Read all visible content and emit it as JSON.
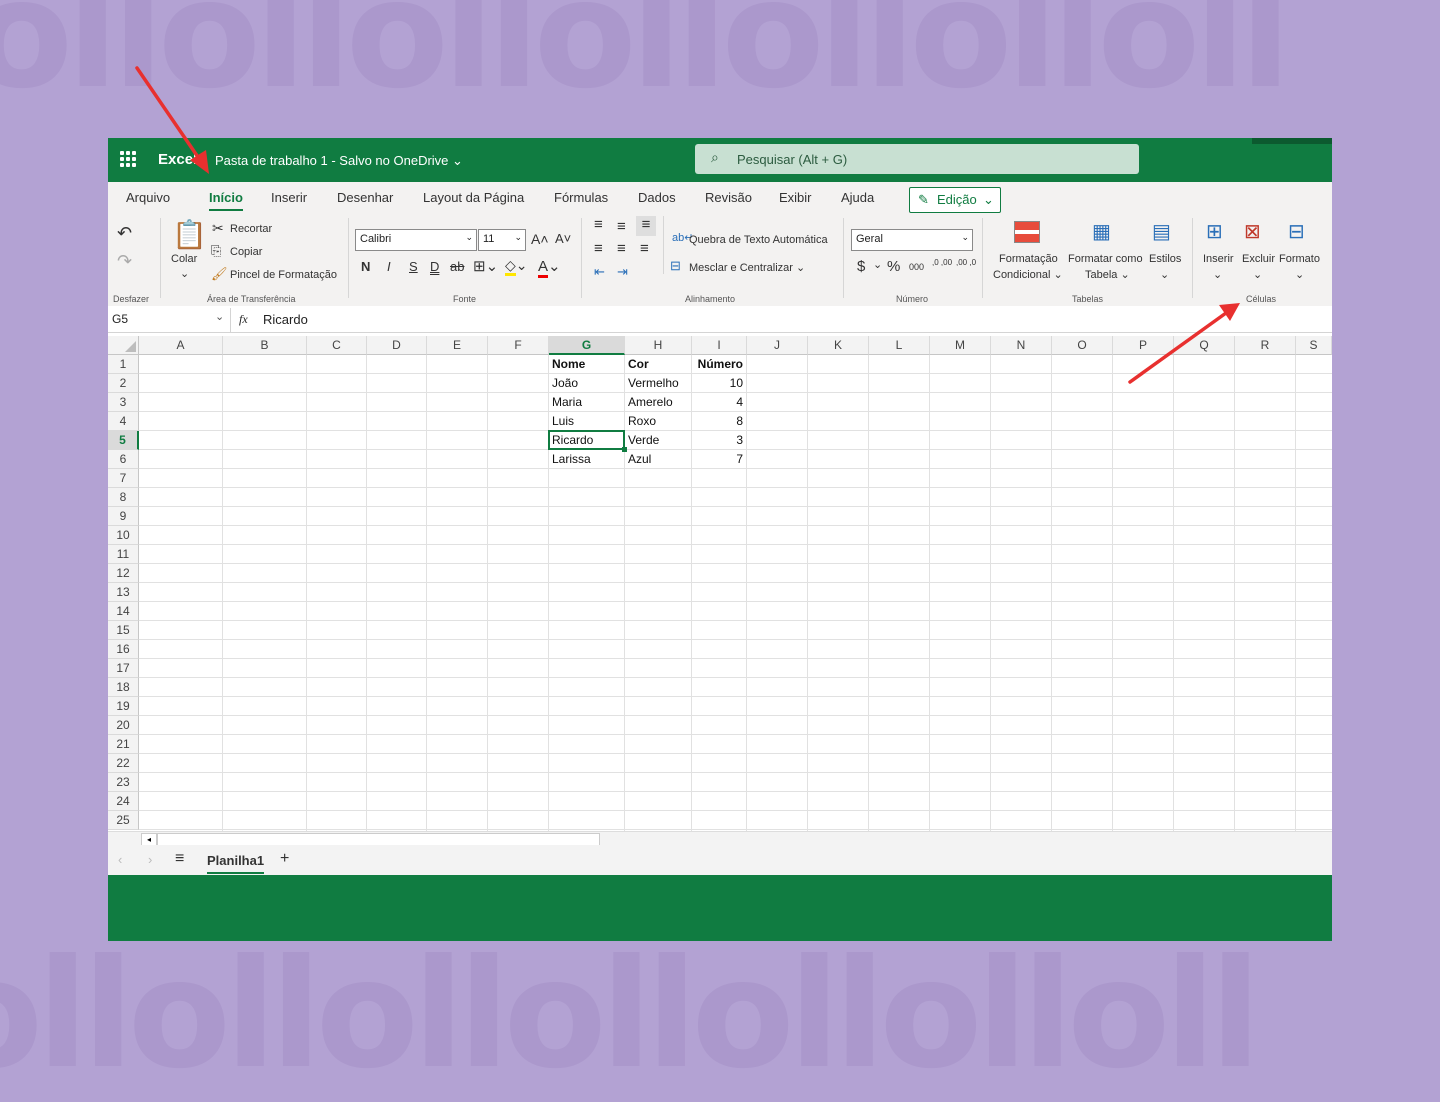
{
  "titlebar": {
    "app_name": "Excel",
    "doc_title": "Pasta de trabalho 1  -  Salvo no OneDrive ⌄",
    "search_placeholder": "Pesquisar (Alt + G)"
  },
  "ribbon": {
    "tabs": [
      "Arquivo",
      "Início",
      "Inserir",
      "Desenhar",
      "Layout da Página",
      "Fórmulas",
      "Dados",
      "Revisão",
      "Exibir",
      "Ajuda"
    ],
    "active_tab": "Início",
    "mode_button": "Edição",
    "clipboard": {
      "paste": "Colar",
      "cut": "Recortar",
      "copy": "Copiar",
      "format_painter": "Pincel de Formatação"
    },
    "font": {
      "family": "Calibri",
      "size": "11",
      "bold": "N",
      "italic": "I",
      "underline": "S",
      "double_underline": "D"
    },
    "alignment": {
      "wrap_text": "Quebra de Texto Automática",
      "merge_center": "Mesclar e Centralizar ⌄"
    },
    "number": {
      "format": "Geral",
      "currency": "$",
      "percent": "%",
      "thousands": "000",
      "inc_decimal": ",0 ,00",
      "dec_decimal": ",00 ,0"
    },
    "tables": {
      "conditional_format": "Formatação",
      "conditional_format_2": "Condicional ⌄",
      "format_table": "Formatar como",
      "format_table_2": "Tabela ⌄",
      "styles": "Estilos"
    },
    "cells": {
      "insert": "Inserir",
      "delete": "Excluir",
      "format": "Formato"
    },
    "groups": {
      "undo": "Desfazer",
      "clipboard": "Área de Transferência",
      "font": "Fonte",
      "alignment": "Alinhamento",
      "number": "Número",
      "tables": "Tabelas",
      "cells": "Células"
    }
  },
  "formula_bar": {
    "name_box": "G5",
    "fx": "fx",
    "value": "Ricardo"
  },
  "columns": [
    "A",
    "B",
    "C",
    "D",
    "E",
    "F",
    "G",
    "H",
    "I",
    "J",
    "K",
    "L",
    "M",
    "N",
    "O",
    "P",
    "Q",
    "R",
    "S"
  ],
  "rows": [
    "1",
    "2",
    "3",
    "4",
    "5",
    "6",
    "7",
    "8",
    "9",
    "10",
    "11",
    "12",
    "13",
    "14",
    "15",
    "16",
    "17",
    "18",
    "19",
    "20",
    "21",
    "22",
    "23",
    "24",
    "25"
  ],
  "selected_cell": "G5",
  "table": {
    "headers": [
      "Nome",
      "Cor",
      "Número"
    ],
    "rows": [
      [
        "João",
        "Vermelho",
        "10"
      ],
      [
        "Maria",
        "Amerelo",
        "4"
      ],
      [
        "Luis",
        "Roxo",
        "8"
      ],
      [
        "Ricardo",
        "Verde",
        "3"
      ],
      [
        "Larissa",
        "Azul",
        "7"
      ]
    ]
  },
  "sheets": {
    "active": "Planilha1",
    "add": "+"
  },
  "colors": {
    "excel_green": "#107c41",
    "background": "#b3a2d3",
    "arrow": "#e8302f"
  }
}
